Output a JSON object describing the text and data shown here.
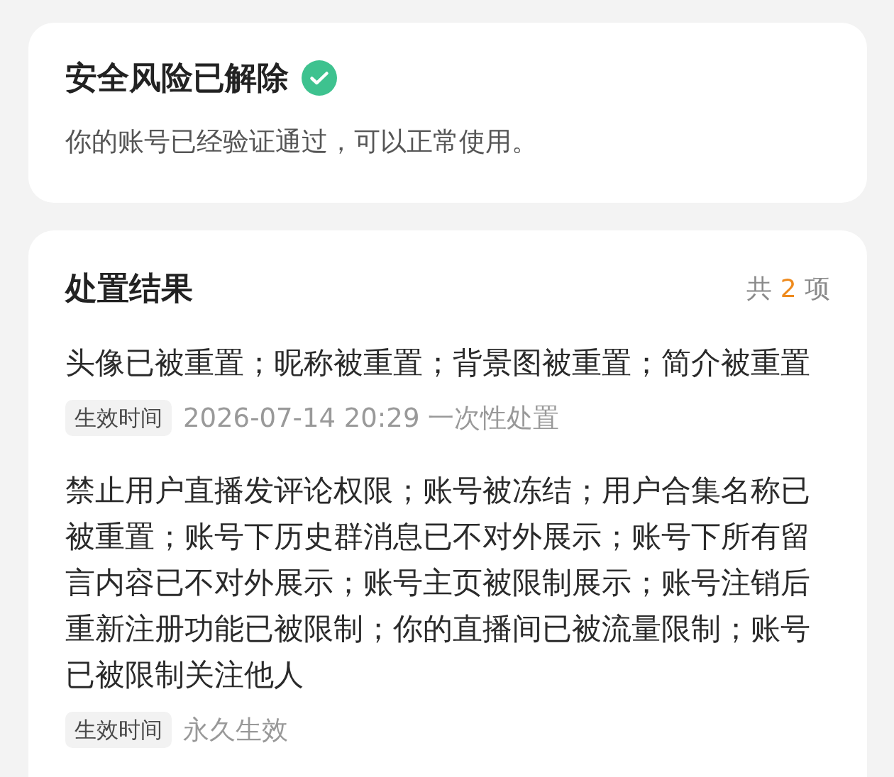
{
  "status_card": {
    "title": "安全风险已解除",
    "verified": true,
    "message": "你的账号已经验证通过，可以正常使用。"
  },
  "results": {
    "title": "处置结果",
    "count_prefix": "共",
    "count": "2",
    "count_suffix": "项",
    "items": [
      {
        "text": "头像已被重置；昵称被重置；背景图被重置；简介被重置",
        "tag": "生效时间",
        "effective": "2026-07-14 20:29 一次性处置"
      },
      {
        "text": "禁止用户直播发评论权限；账号被冻结；用户合集名称已被重置；账号下历史群消息已不对外展示；账号下所有留言内容已不对外展示；账号主页被限制展示；账号注销后重新注册功能已被限制；你的直播间已被流量限制；账号已被限制关注他人",
        "tag": "生效时间",
        "effective": "永久生效"
      }
    ]
  }
}
